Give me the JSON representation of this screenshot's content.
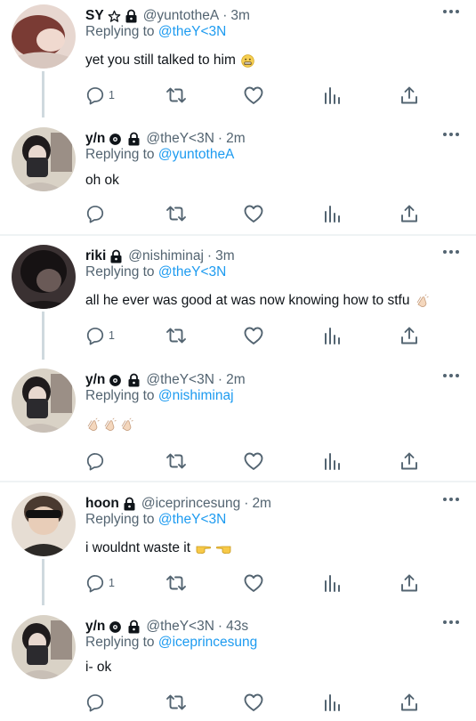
{
  "tweets": [
    {
      "name": "SY",
      "badges": [
        "star-icon",
        "lock-icon"
      ],
      "handle": "@yuntotheA",
      "time": "3m",
      "replying_prefix": "Replying to",
      "replying_to": "@theY<3N",
      "text": "yet you still talked to him",
      "emojis": [
        "grimacing-emoji"
      ],
      "reply_count": "1",
      "colors": {
        "avatar": "#c9a49b"
      }
    },
    {
      "name": "y/n",
      "badges": [
        "gear-icon",
        "lock-icon"
      ],
      "handle": "@theY<3N",
      "time": "2m",
      "replying_prefix": "Replying to",
      "replying_to": "@yuntotheA",
      "text": "oh ok",
      "emojis": [],
      "reply_count": "",
      "colors": {
        "avatar": "#a8a29e"
      }
    },
    {
      "name": "riki",
      "badges": [
        "lock-icon"
      ],
      "handle": "@nishiminaj",
      "time": "3m",
      "replying_prefix": "Replying to",
      "replying_to": "@theY<3N",
      "text": "all he ever was good at was now knowing how to stfu",
      "emojis": [
        "clapping-hands-emoji"
      ],
      "reply_count": "1",
      "colors": {
        "avatar": "#2c2526"
      }
    },
    {
      "name": "y/n",
      "badges": [
        "gear-icon",
        "lock-icon"
      ],
      "handle": "@theY<3N",
      "time": "2m",
      "replying_prefix": "Replying to",
      "replying_to": "@nishiminaj",
      "text": "",
      "emojis": [
        "clapping-hands-emoji",
        "clapping-hands-emoji",
        "clapping-hands-emoji"
      ],
      "reply_count": "",
      "colors": {
        "avatar": "#a8a29e"
      }
    },
    {
      "name": "hoon",
      "badges": [
        "lock-icon"
      ],
      "handle": "@iceprincesung",
      "time": "2m",
      "replying_prefix": "Replying to",
      "replying_to": "@theY<3N",
      "text": "i wouldnt waste it",
      "emojis": [
        "backhand-index-pointing-right-emoji",
        "backhand-index-pointing-left-emoji"
      ],
      "reply_count": "1",
      "colors": {
        "avatar": "#d6c4b5"
      }
    },
    {
      "name": "y/n",
      "badges": [
        "gear-icon",
        "lock-icon"
      ],
      "handle": "@theY<3N",
      "time": "43s",
      "replying_prefix": "Replying to",
      "replying_to": "@iceprincesung",
      "text": "i- ok",
      "emojis": [],
      "reply_count": "",
      "colors": {
        "avatar": "#a8a29e"
      }
    }
  ],
  "colors": {
    "text": "#0f1419",
    "muted": "#536471",
    "link": "#1d9bf0",
    "divider": "#eff3f4",
    "thread_line": "#cfd9de"
  }
}
